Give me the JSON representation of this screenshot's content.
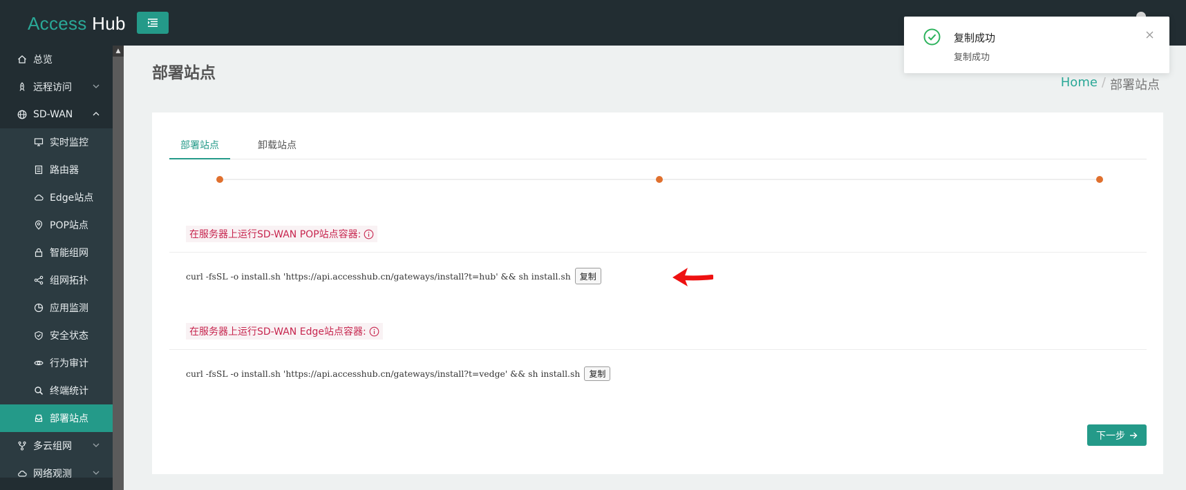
{
  "brand": {
    "part1": "Access",
    "part2": "Hub"
  },
  "sidebar": {
    "items": [
      {
        "label": "总览",
        "icon": "home-icon"
      },
      {
        "label": "远程访问",
        "icon": "rocket-icon",
        "chevron": "down"
      },
      {
        "label": "SD-WAN",
        "icon": "globe-icon",
        "chevron": "up"
      },
      {
        "label": "实时监控",
        "icon": "monitor-icon"
      },
      {
        "label": "路由器",
        "icon": "router-icon"
      },
      {
        "label": "Edge站点",
        "icon": "cloud-icon"
      },
      {
        "label": "POP站点",
        "icon": "location-pin-icon"
      },
      {
        "label": "智能组网",
        "icon": "lock-icon"
      },
      {
        "label": "组网拓扑",
        "icon": "share-icon"
      },
      {
        "label": "应用监测",
        "icon": "pie-chart-icon"
      },
      {
        "label": "安全状态",
        "icon": "shield-check-icon"
      },
      {
        "label": "行为审计",
        "icon": "eye-icon"
      },
      {
        "label": "终端统计",
        "icon": "search-icon"
      },
      {
        "label": "部署站点",
        "icon": "inbox-icon",
        "active": true
      },
      {
        "label": "多云组网",
        "icon": "fork-icon",
        "chevron": "down"
      },
      {
        "label": "网络观测",
        "icon": "cloud-icon",
        "chevron": "down"
      }
    ]
  },
  "page": {
    "title": "部署站点"
  },
  "breadcrumb": {
    "home": "Home",
    "separator": "/",
    "current": "部署站点"
  },
  "tabs": [
    {
      "label": "部署站点",
      "active": true
    },
    {
      "label": "卸载站点",
      "active": false
    }
  ],
  "steps": {
    "count": 3,
    "current": 1,
    "color": "#e0702e"
  },
  "sections": [
    {
      "label": "在服务器上运行SD-WAN POP站点容器:",
      "command": "curl -fsSL -o install.sh 'https://api.accesshub.cn/gateways/install?t=hub' && sh install.sh",
      "copy_label": "复制"
    },
    {
      "label": "在服务器上运行SD-WAN Edge站点容器:",
      "command": "curl -fsSL -o install.sh 'https://api.accesshub.cn/gateways/install?t=vedge' && sh install.sh",
      "copy_label": "复制"
    }
  ],
  "next_button": {
    "label": "下一步"
  },
  "toast": {
    "title": "复制成功",
    "description": "复制成功",
    "icon": "check-circle-icon"
  },
  "colors": {
    "accent": "#249a89",
    "sidebar": "#222d32",
    "step": "#e0702e",
    "label_text": "#c7254e",
    "success": "#2db35d",
    "arrow": "#ee1111"
  }
}
